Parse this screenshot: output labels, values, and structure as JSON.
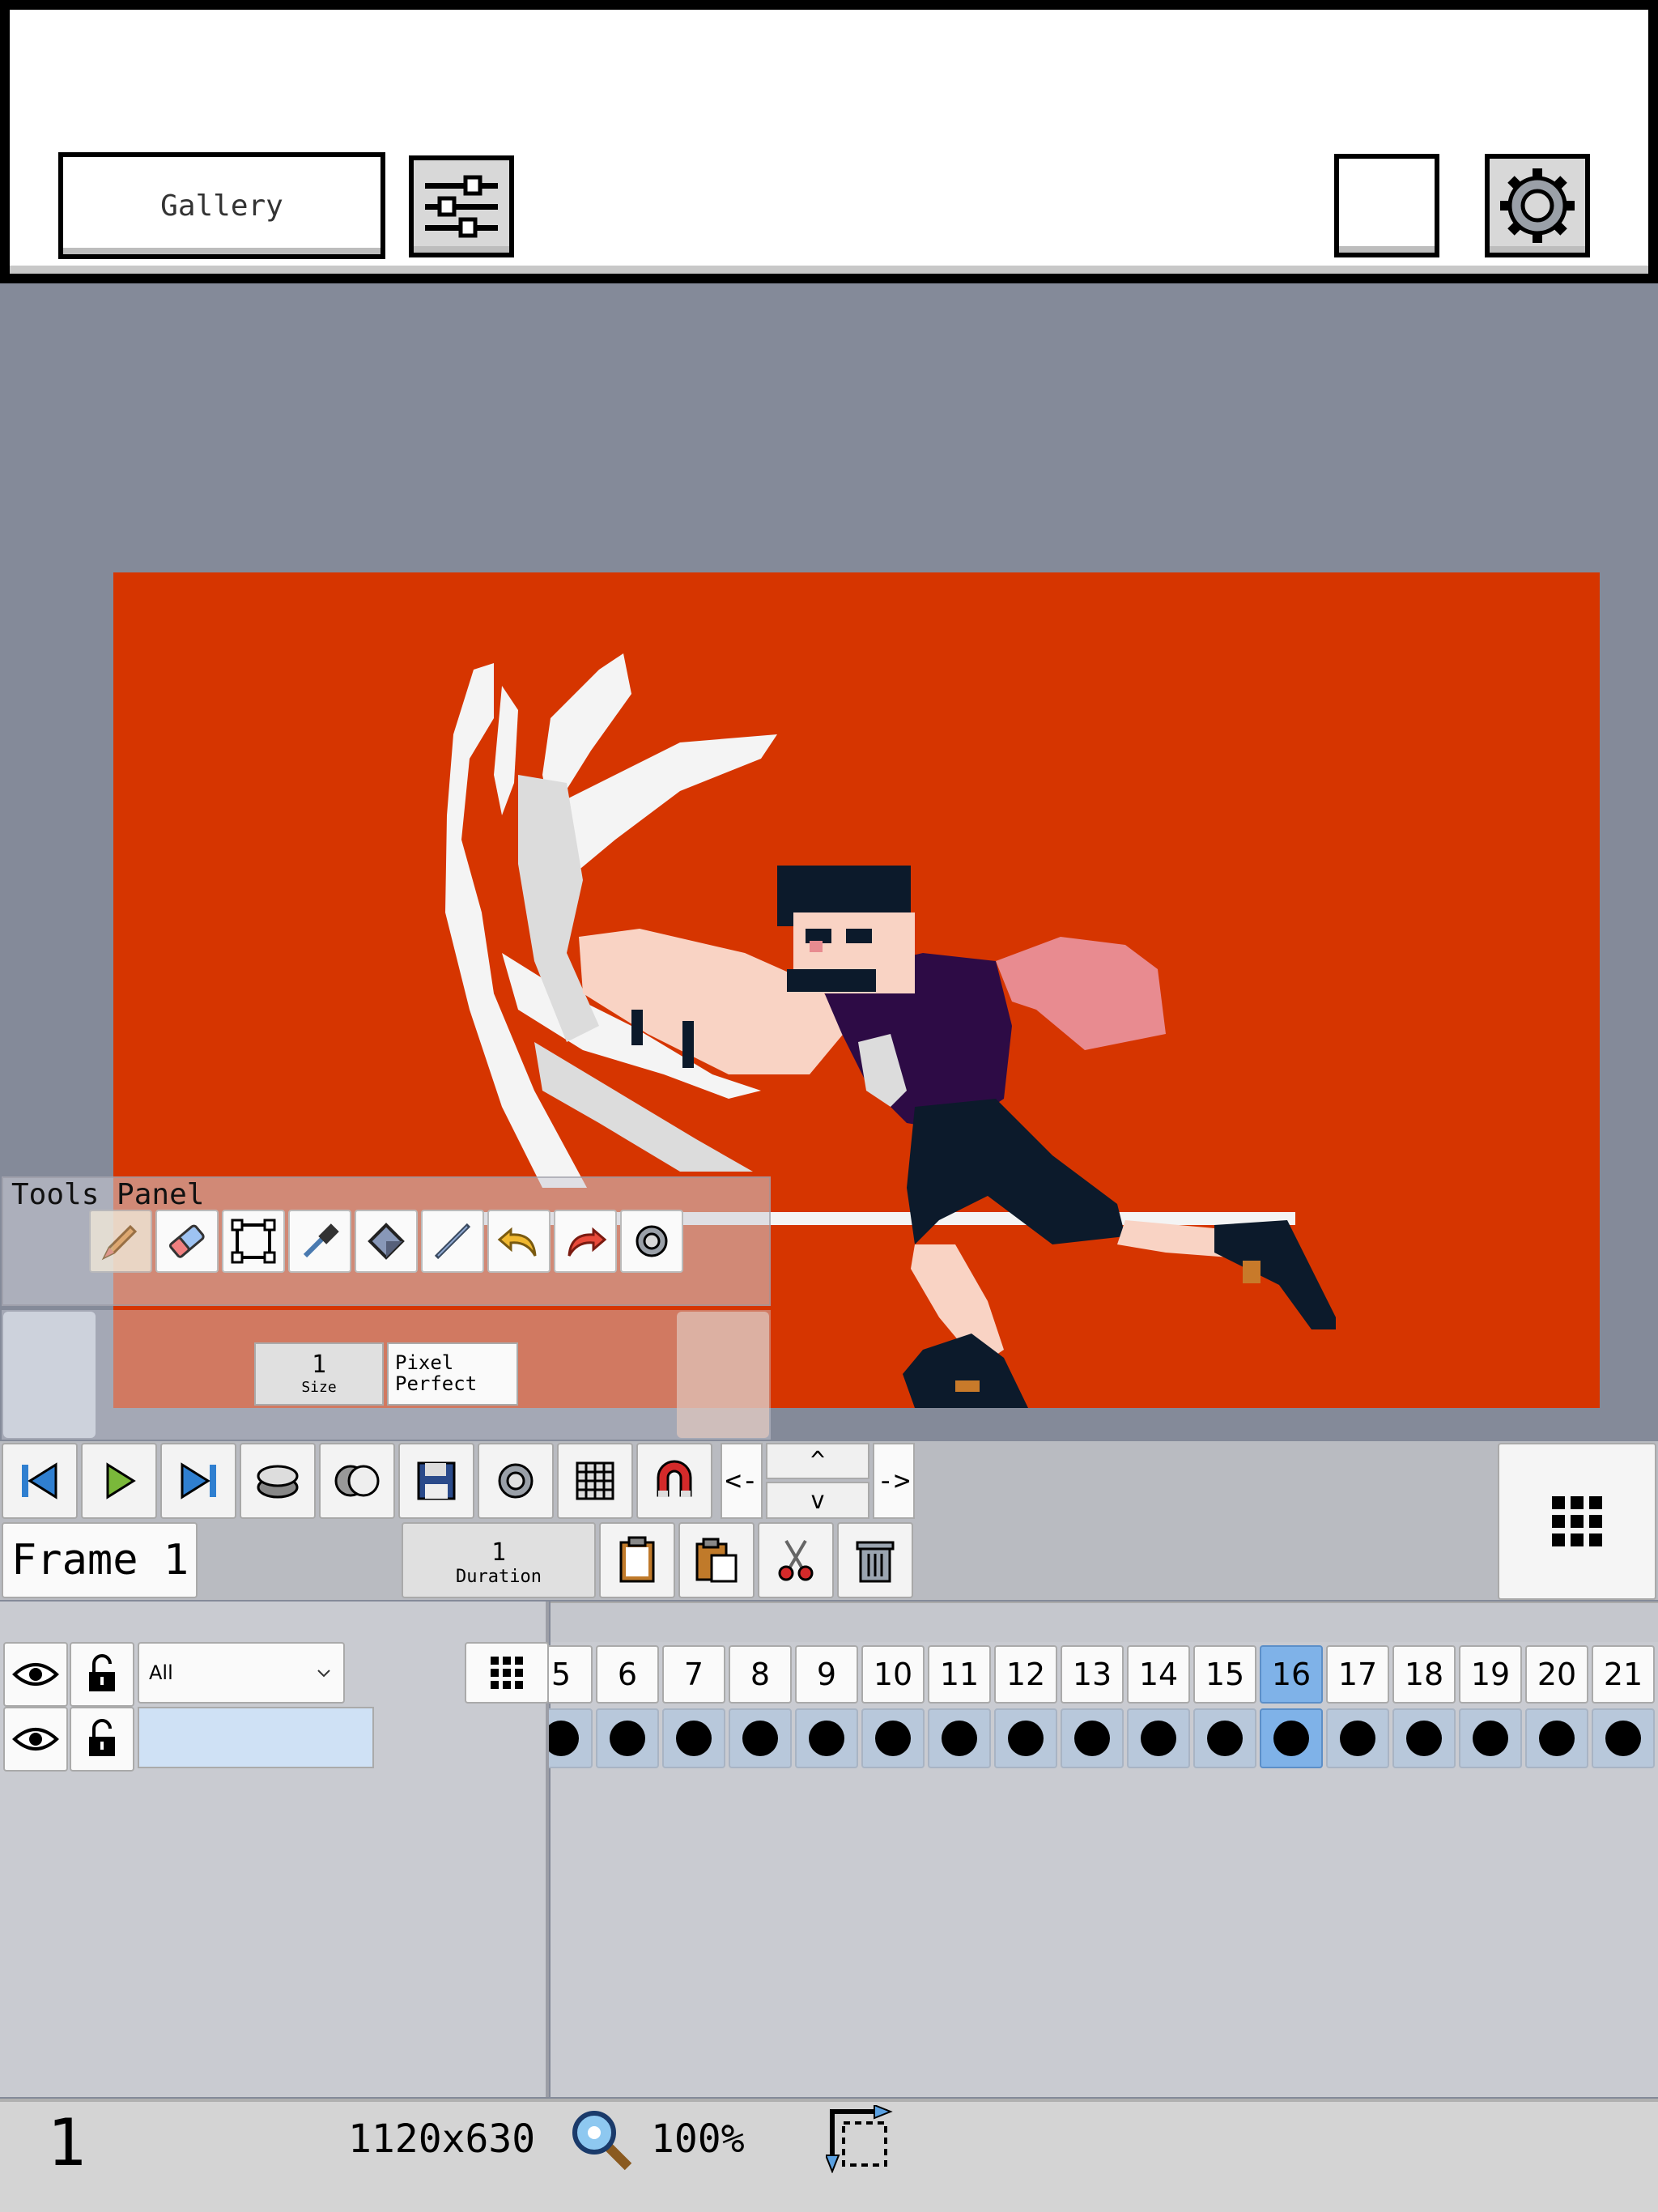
{
  "topbar": {
    "gallery_label": "Gallery"
  },
  "tools_panel": {
    "title": "Tools Panel",
    "size_value": "1",
    "size_label": "Size",
    "pixel_perfect_label": "Pixel Perfect"
  },
  "toolbar": {
    "nav_left": "<-",
    "nav_right": "->",
    "nav_up": "^",
    "nav_down": "v"
  },
  "frame": {
    "label": "Frame 1",
    "duration_value": "1",
    "duration_label": "Duration"
  },
  "layers": {
    "filter_selected": "All"
  },
  "timeline": {
    "frames": [
      "5",
      "6",
      "7",
      "8",
      "9",
      "10",
      "11",
      "12",
      "13",
      "14",
      "15",
      "16",
      "17",
      "18",
      "19",
      "20",
      "21"
    ],
    "selected_frame": "16"
  },
  "status": {
    "layer_number": "1",
    "canvas_size": "1120x630",
    "zoom": "100%"
  },
  "colors": {
    "canvas_bg": "#d63500",
    "selection": "#7fb2e8",
    "workspace": "#848a99"
  }
}
